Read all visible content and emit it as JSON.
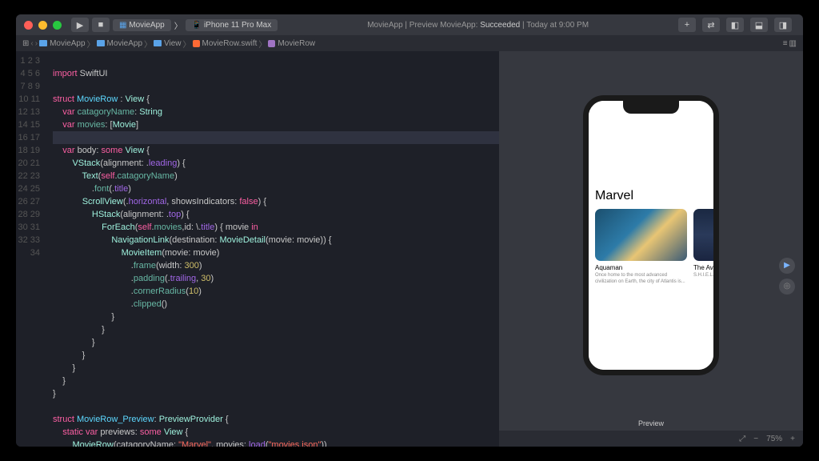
{
  "titlebar": {
    "scheme_app": "MovieApp",
    "scheme_device": "iPhone 11 Pro Max",
    "status_prefix": "MovieApp | Preview MovieApp:",
    "status_result": "Succeeded",
    "status_time": "Today at 9:00 PM"
  },
  "crumbs": [
    "MovieApp",
    "MovieApp",
    "View",
    "MovieRow.swift",
    "MovieRow"
  ],
  "code": {
    "lines": 34
  },
  "preview": {
    "category": "Marvel",
    "label": "Preview",
    "cards": [
      {
        "title": "Aquaman",
        "desc": "Once home to the most advanced civilization on Earth, the city of Atlantis is..."
      },
      {
        "title": "The Aven",
        "desc": "S.H.I.E.L.D launch the..."
      }
    ]
  },
  "footer": {
    "zoom": "75%"
  }
}
